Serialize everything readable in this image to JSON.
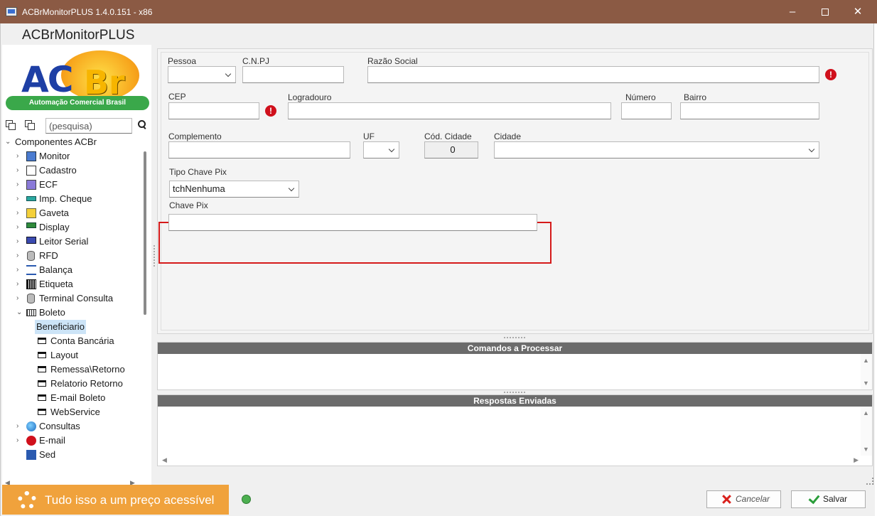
{
  "window": {
    "title": "ACBrMonitorPLUS 1.4.0.151 - x86",
    "minimize": "–",
    "close": "✕"
  },
  "app": {
    "header": "ACBrMonitorPLUS"
  },
  "logo": {
    "ac": "AC",
    "br": "Br",
    "tagline": "Automação Comercial Brasil"
  },
  "search": {
    "placeholder": "(pesquisa)"
  },
  "tree": {
    "root": "Componentes ACBr",
    "items": [
      {
        "label": "Monitor",
        "icon": "monitor-icon"
      },
      {
        "label": "Cadastro",
        "icon": "edit-icon"
      },
      {
        "label": "ECF",
        "icon": "printer-icon"
      },
      {
        "label": "Imp. Cheque",
        "icon": "cheque-icon"
      },
      {
        "label": "Gaveta",
        "icon": "drawer-icon"
      },
      {
        "label": "Display",
        "icon": "display-icon"
      },
      {
        "label": "Leitor Serial",
        "icon": "keyboard-icon"
      },
      {
        "label": "RFD",
        "icon": "database-icon"
      },
      {
        "label": "Balança",
        "icon": "scale-icon"
      },
      {
        "label": "Etiqueta",
        "icon": "barcode-icon"
      },
      {
        "label": "Terminal Consulta",
        "icon": "database-icon"
      },
      {
        "label": "Boleto",
        "icon": "boleto-icon"
      }
    ],
    "boleto_children": [
      "Beneficiario",
      "Conta Bancária",
      "Layout",
      "Remessa\\Retorno",
      "Relatorio Retorno",
      "E-mail Boleto",
      "WebService"
    ],
    "after": [
      {
        "label": "Consultas",
        "icon": "globe-icon"
      },
      {
        "label": "E-mail",
        "icon": "alert-icon"
      }
    ],
    "partial": "Sed"
  },
  "form": {
    "pessoa": {
      "label": "Pessoa",
      "value": ""
    },
    "cnpj": {
      "label": "C.N.PJ",
      "value": ""
    },
    "razao": {
      "label": "Razão Social",
      "value": ""
    },
    "cep": {
      "label": "CEP",
      "value": ""
    },
    "logradouro": {
      "label": "Logradouro",
      "value": ""
    },
    "numero": {
      "label": "Número",
      "value": ""
    },
    "bairro": {
      "label": "Bairro",
      "value": ""
    },
    "complemento": {
      "label": "Complemento",
      "value": ""
    },
    "uf": {
      "label": "UF",
      "value": ""
    },
    "cod_cidade": {
      "label": "Cód. Cidade",
      "value": "0"
    },
    "cidade": {
      "label": "Cidade",
      "value": ""
    },
    "tipo_chave": {
      "label": "Tipo Chave Pix",
      "value": "tchNenhuma"
    },
    "chave_pix": {
      "label": "Chave Pix",
      "value": ""
    },
    "error_mark": "!"
  },
  "logs": {
    "commands": "Comandos a Processar",
    "responses": "Respostas Enviadas"
  },
  "bottom": {
    "promo": "Tudo isso a um preço acessível",
    "cancel": "Cancelar",
    "save": "Salvar"
  },
  "colors": {
    "titlebar": "#8b5a44",
    "promo": "#f0a23c",
    "error": "#d0101c",
    "highlight": "#d51a1a",
    "log_header": "#6b6b6b"
  }
}
